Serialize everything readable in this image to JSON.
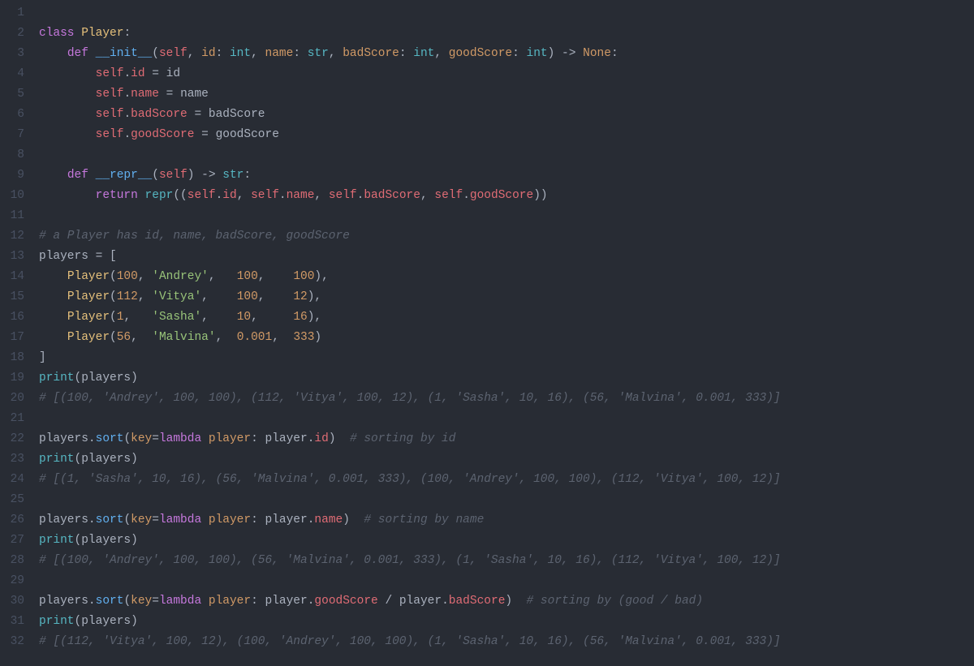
{
  "lineNumbers": [
    "1",
    "2",
    "3",
    "4",
    "5",
    "6",
    "7",
    "8",
    "9",
    "10",
    "11",
    "12",
    "13",
    "14",
    "15",
    "16",
    "17",
    "18",
    "19",
    "20",
    "21",
    "22",
    "23",
    "24",
    "25",
    "26",
    "27",
    "28",
    "29",
    "30",
    "31",
    "32"
  ],
  "lines": [
    [],
    [
      {
        "t": "class ",
        "c": "kw"
      },
      {
        "t": "Player",
        "c": "cls"
      },
      {
        "t": ":",
        "c": "punct"
      }
    ],
    [
      {
        "t": "    ",
        "c": ""
      },
      {
        "t": "def ",
        "c": "kw"
      },
      {
        "t": "__init__",
        "c": "fn"
      },
      {
        "t": "(",
        "c": "punct"
      },
      {
        "t": "self",
        "c": "slf"
      },
      {
        "t": ", ",
        "c": "punct"
      },
      {
        "t": "id",
        "c": "paramn"
      },
      {
        "t": ": ",
        "c": "punct"
      },
      {
        "t": "int",
        "c": "builtin"
      },
      {
        "t": ", ",
        "c": "punct"
      },
      {
        "t": "name",
        "c": "paramn"
      },
      {
        "t": ": ",
        "c": "punct"
      },
      {
        "t": "str",
        "c": "builtin"
      },
      {
        "t": ", ",
        "c": "punct"
      },
      {
        "t": "badScore",
        "c": "paramn"
      },
      {
        "t": ": ",
        "c": "punct"
      },
      {
        "t": "int",
        "c": "builtin"
      },
      {
        "t": ", ",
        "c": "punct"
      },
      {
        "t": "goodScore",
        "c": "paramn"
      },
      {
        "t": ": ",
        "c": "punct"
      },
      {
        "t": "int",
        "c": "builtin"
      },
      {
        "t": ") -> ",
        "c": "punct"
      },
      {
        "t": "None",
        "c": "none"
      },
      {
        "t": ":",
        "c": "punct"
      }
    ],
    [
      {
        "t": "        ",
        "c": ""
      },
      {
        "t": "self",
        "c": "slf"
      },
      {
        "t": ".",
        "c": "punct"
      },
      {
        "t": "id",
        "c": "prop"
      },
      {
        "t": " = ",
        "c": "punct"
      },
      {
        "t": "id",
        "c": "var"
      }
    ],
    [
      {
        "t": "        ",
        "c": ""
      },
      {
        "t": "self",
        "c": "slf"
      },
      {
        "t": ".",
        "c": "punct"
      },
      {
        "t": "name",
        "c": "prop"
      },
      {
        "t": " = ",
        "c": "punct"
      },
      {
        "t": "name",
        "c": "var"
      }
    ],
    [
      {
        "t": "        ",
        "c": ""
      },
      {
        "t": "self",
        "c": "slf"
      },
      {
        "t": ".",
        "c": "punct"
      },
      {
        "t": "badScore",
        "c": "prop"
      },
      {
        "t": " = ",
        "c": "punct"
      },
      {
        "t": "badScore",
        "c": "var"
      }
    ],
    [
      {
        "t": "        ",
        "c": ""
      },
      {
        "t": "self",
        "c": "slf"
      },
      {
        "t": ".",
        "c": "punct"
      },
      {
        "t": "goodScore",
        "c": "prop"
      },
      {
        "t": " = ",
        "c": "punct"
      },
      {
        "t": "goodScore",
        "c": "var"
      }
    ],
    [],
    [
      {
        "t": "    ",
        "c": ""
      },
      {
        "t": "def ",
        "c": "kw"
      },
      {
        "t": "__repr__",
        "c": "fn"
      },
      {
        "t": "(",
        "c": "punct"
      },
      {
        "t": "self",
        "c": "slf"
      },
      {
        "t": ") -> ",
        "c": "punct"
      },
      {
        "t": "str",
        "c": "builtin"
      },
      {
        "t": ":",
        "c": "punct"
      }
    ],
    [
      {
        "t": "        ",
        "c": ""
      },
      {
        "t": "return ",
        "c": "kw"
      },
      {
        "t": "repr",
        "c": "builtin"
      },
      {
        "t": "((",
        "c": "punct"
      },
      {
        "t": "self",
        "c": "slf"
      },
      {
        "t": ".",
        "c": "punct"
      },
      {
        "t": "id",
        "c": "prop"
      },
      {
        "t": ", ",
        "c": "punct"
      },
      {
        "t": "self",
        "c": "slf"
      },
      {
        "t": ".",
        "c": "punct"
      },
      {
        "t": "name",
        "c": "prop"
      },
      {
        "t": ", ",
        "c": "punct"
      },
      {
        "t": "self",
        "c": "slf"
      },
      {
        "t": ".",
        "c": "punct"
      },
      {
        "t": "badScore",
        "c": "prop"
      },
      {
        "t": ", ",
        "c": "punct"
      },
      {
        "t": "self",
        "c": "slf"
      },
      {
        "t": ".",
        "c": "punct"
      },
      {
        "t": "goodScore",
        "c": "prop"
      },
      {
        "t": "))",
        "c": "punct"
      }
    ],
    [],
    [
      {
        "t": "# a Player has id, name, badScore, goodScore",
        "c": "cmt"
      }
    ],
    [
      {
        "t": "players",
        "c": "var"
      },
      {
        "t": " = [",
        "c": "punct"
      }
    ],
    [
      {
        "t": "    ",
        "c": ""
      },
      {
        "t": "Player",
        "c": "cls"
      },
      {
        "t": "(",
        "c": "punct"
      },
      {
        "t": "100",
        "c": "num"
      },
      {
        "t": ", ",
        "c": "punct"
      },
      {
        "t": "'Andrey'",
        "c": "str"
      },
      {
        "t": ",   ",
        "c": "punct"
      },
      {
        "t": "100",
        "c": "num"
      },
      {
        "t": ",    ",
        "c": "punct"
      },
      {
        "t": "100",
        "c": "num"
      },
      {
        "t": "),",
        "c": "punct"
      }
    ],
    [
      {
        "t": "    ",
        "c": ""
      },
      {
        "t": "Player",
        "c": "cls"
      },
      {
        "t": "(",
        "c": "punct"
      },
      {
        "t": "112",
        "c": "num"
      },
      {
        "t": ", ",
        "c": "punct"
      },
      {
        "t": "'Vitya'",
        "c": "str"
      },
      {
        "t": ",    ",
        "c": "punct"
      },
      {
        "t": "100",
        "c": "num"
      },
      {
        "t": ",    ",
        "c": "punct"
      },
      {
        "t": "12",
        "c": "num"
      },
      {
        "t": "),",
        "c": "punct"
      }
    ],
    [
      {
        "t": "    ",
        "c": ""
      },
      {
        "t": "Player",
        "c": "cls"
      },
      {
        "t": "(",
        "c": "punct"
      },
      {
        "t": "1",
        "c": "num"
      },
      {
        "t": ",   ",
        "c": "punct"
      },
      {
        "t": "'Sasha'",
        "c": "str"
      },
      {
        "t": ",    ",
        "c": "punct"
      },
      {
        "t": "10",
        "c": "num"
      },
      {
        "t": ",     ",
        "c": "punct"
      },
      {
        "t": "16",
        "c": "num"
      },
      {
        "t": "),",
        "c": "punct"
      }
    ],
    [
      {
        "t": "    ",
        "c": ""
      },
      {
        "t": "Player",
        "c": "cls"
      },
      {
        "t": "(",
        "c": "punct"
      },
      {
        "t": "56",
        "c": "num"
      },
      {
        "t": ",  ",
        "c": "punct"
      },
      {
        "t": "'Malvina'",
        "c": "str"
      },
      {
        "t": ",  ",
        "c": "punct"
      },
      {
        "t": "0.001",
        "c": "num"
      },
      {
        "t": ",  ",
        "c": "punct"
      },
      {
        "t": "333",
        "c": "num"
      },
      {
        "t": ")",
        "c": "punct"
      }
    ],
    [
      {
        "t": "]",
        "c": "punct"
      }
    ],
    [
      {
        "t": "print",
        "c": "builtin"
      },
      {
        "t": "(",
        "c": "punct"
      },
      {
        "t": "players",
        "c": "var"
      },
      {
        "t": ")",
        "c": "punct"
      }
    ],
    [
      {
        "t": "# [(100, 'Andrey', 100, 100), (112, 'Vitya', 100, 12), (1, 'Sasha', 10, 16), (56, 'Malvina', 0.001, 333)]",
        "c": "cmt"
      }
    ],
    [],
    [
      {
        "t": "players",
        "c": "var"
      },
      {
        "t": ".",
        "c": "punct"
      },
      {
        "t": "sort",
        "c": "fn"
      },
      {
        "t": "(",
        "c": "punct"
      },
      {
        "t": "key",
        "c": "paramn"
      },
      {
        "t": "=",
        "c": "punct"
      },
      {
        "t": "lambda",
        "c": "kw"
      },
      {
        "t": " ",
        "c": ""
      },
      {
        "t": "player",
        "c": "paramn"
      },
      {
        "t": ": ",
        "c": "punct"
      },
      {
        "t": "player",
        "c": "var"
      },
      {
        "t": ".",
        "c": "punct"
      },
      {
        "t": "id",
        "c": "prop"
      },
      {
        "t": ")  ",
        "c": "punct"
      },
      {
        "t": "# sorting by id",
        "c": "cmt"
      }
    ],
    [
      {
        "t": "print",
        "c": "builtin"
      },
      {
        "t": "(",
        "c": "punct"
      },
      {
        "t": "players",
        "c": "var"
      },
      {
        "t": ")",
        "c": "punct"
      }
    ],
    [
      {
        "t": "# [(1, 'Sasha', 10, 16), (56, 'Malvina', 0.001, 333), (100, 'Andrey', 100, 100), (112, 'Vitya', 100, 12)]",
        "c": "cmt"
      }
    ],
    [],
    [
      {
        "t": "players",
        "c": "var"
      },
      {
        "t": ".",
        "c": "punct"
      },
      {
        "t": "sort",
        "c": "fn"
      },
      {
        "t": "(",
        "c": "punct"
      },
      {
        "t": "key",
        "c": "paramn"
      },
      {
        "t": "=",
        "c": "punct"
      },
      {
        "t": "lambda",
        "c": "kw"
      },
      {
        "t": " ",
        "c": ""
      },
      {
        "t": "player",
        "c": "paramn"
      },
      {
        "t": ": ",
        "c": "punct"
      },
      {
        "t": "player",
        "c": "var"
      },
      {
        "t": ".",
        "c": "punct"
      },
      {
        "t": "name",
        "c": "prop"
      },
      {
        "t": ")  ",
        "c": "punct"
      },
      {
        "t": "# sorting by name",
        "c": "cmt"
      }
    ],
    [
      {
        "t": "print",
        "c": "builtin"
      },
      {
        "t": "(",
        "c": "punct"
      },
      {
        "t": "players",
        "c": "var"
      },
      {
        "t": ")",
        "c": "punct"
      }
    ],
    [
      {
        "t": "# [(100, 'Andrey', 100, 100), (56, 'Malvina', 0.001, 333), (1, 'Sasha', 10, 16), (112, 'Vitya', 100, 12)]",
        "c": "cmt"
      }
    ],
    [],
    [
      {
        "t": "players",
        "c": "var"
      },
      {
        "t": ".",
        "c": "punct"
      },
      {
        "t": "sort",
        "c": "fn"
      },
      {
        "t": "(",
        "c": "punct"
      },
      {
        "t": "key",
        "c": "paramn"
      },
      {
        "t": "=",
        "c": "punct"
      },
      {
        "t": "lambda",
        "c": "kw"
      },
      {
        "t": " ",
        "c": ""
      },
      {
        "t": "player",
        "c": "paramn"
      },
      {
        "t": ": ",
        "c": "punct"
      },
      {
        "t": "player",
        "c": "var"
      },
      {
        "t": ".",
        "c": "punct"
      },
      {
        "t": "goodScore",
        "c": "prop"
      },
      {
        "t": " / ",
        "c": "punct"
      },
      {
        "t": "player",
        "c": "var"
      },
      {
        "t": ".",
        "c": "punct"
      },
      {
        "t": "badScore",
        "c": "prop"
      },
      {
        "t": ")  ",
        "c": "punct"
      },
      {
        "t": "# sorting by (good / bad)",
        "c": "cmt"
      }
    ],
    [
      {
        "t": "print",
        "c": "builtin"
      },
      {
        "t": "(",
        "c": "punct"
      },
      {
        "t": "players",
        "c": "var"
      },
      {
        "t": ")",
        "c": "punct"
      }
    ],
    [
      {
        "t": "# [(112, 'Vitya', 100, 12), (100, 'Andrey', 100, 100), (1, 'Sasha', 10, 16), (56, 'Malvina', 0.001, 333)]",
        "c": "cmt"
      }
    ]
  ]
}
